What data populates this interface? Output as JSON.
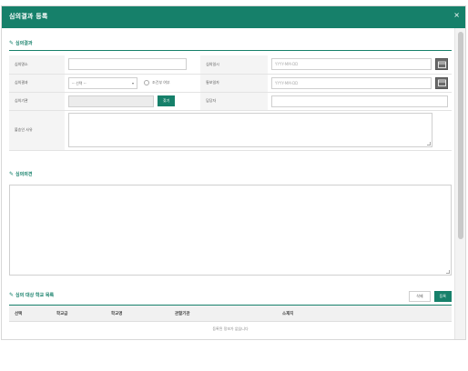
{
  "dialog": {
    "title": "심의결과 등록",
    "close_label": "×"
  },
  "result_section": {
    "title": "심의결과",
    "rows": [
      {
        "label_left": "심의명소",
        "label_right": "심의일시",
        "right_placeholder": "YYYY-MM-DD"
      },
      {
        "label_left": "심의결과",
        "select_value": "-- 선택 --",
        "checkbox_label": "조건부 여부",
        "label_right": "통보일자",
        "right_placeholder": "YYYY-MM-DD"
      },
      {
        "label_left": "심의기관",
        "button_label": "찾기",
        "label_right": "담당자"
      },
      {
        "label_left": "불승인 사유"
      }
    ]
  },
  "opinion_section": {
    "title": "심의의견"
  },
  "target_section": {
    "title": "심의 대상 학교 목록",
    "delete_button": "삭제",
    "register_button": "등록",
    "columns": [
      "선택",
      "학교급",
      "학교명",
      "관할기관",
      "소재지"
    ],
    "empty_message": "등록된 정보가 없습니다"
  },
  "icons": {
    "edit": "pencil-icon",
    "calendar": "calendar-icon",
    "close": "close-icon"
  },
  "colors": {
    "accent": "#16806a"
  }
}
